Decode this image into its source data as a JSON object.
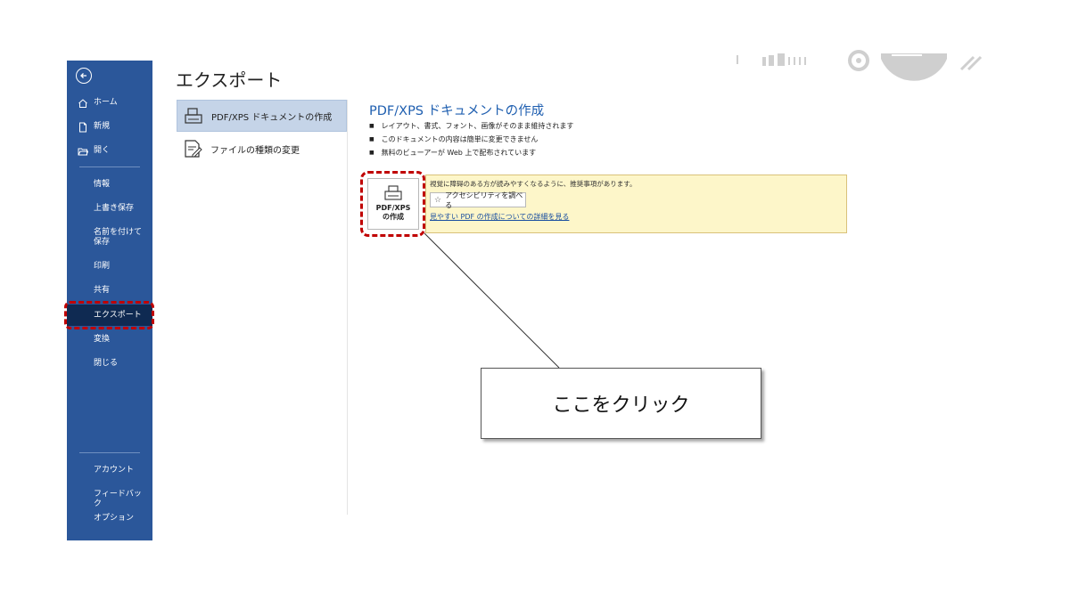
{
  "sidebar": {
    "items": [
      {
        "label": "ホーム",
        "icon": "home-icon"
      },
      {
        "label": "新規",
        "icon": "new-document-icon"
      },
      {
        "label": "開く",
        "icon": "open-folder-icon"
      },
      {
        "label": "情報"
      },
      {
        "label": "上書き保存"
      },
      {
        "label": "名前を付けて保存"
      },
      {
        "label": "印刷"
      },
      {
        "label": "共有"
      },
      {
        "label": "エクスポート",
        "active": true
      },
      {
        "label": "変換"
      },
      {
        "label": "閉じる"
      },
      {
        "label": "アカウント"
      },
      {
        "label": "フィードバック"
      },
      {
        "label": "オプション"
      }
    ]
  },
  "page": {
    "title": "エクスポート"
  },
  "export_options": [
    {
      "label": "PDF/XPS ドキュメントの作成",
      "selected": true,
      "icon": "pdf-document-icon"
    },
    {
      "label": "ファイルの種類の変更",
      "icon": "file-type-icon"
    }
  ],
  "panel": {
    "title": "PDF/XPS ドキュメントの作成",
    "bullets": [
      "レイアウト、書式、フォント、画像がそのまま維持されます",
      "このドキュメントの内容は簡単に変更できません",
      "無料のビューアーが Web 上で配布されています"
    ],
    "warning": "視覚に障碍のある方が読みやすくなるように、推奨事項があります。",
    "accessibility_button": "アクセシビリティを調べる",
    "learn_more_link": "見やすい PDF の作成についての詳細を見る",
    "create_button": {
      "line1": "PDF/XPS",
      "line2": "の作成"
    }
  },
  "callout": {
    "text": "ここをクリック"
  },
  "colors": {
    "sidebar": "#2b579a",
    "active": "#0f2a52",
    "highlight": "#c00000",
    "accent": "#1f5fb0"
  }
}
